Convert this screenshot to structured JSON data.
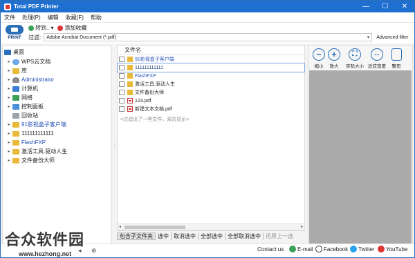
{
  "window": {
    "title": "Total PDF Printer",
    "controls": [
      "—",
      "☐",
      "✕"
    ]
  },
  "menu": [
    "文件",
    "处理(P)",
    "编辑",
    "收藏(F)",
    "帮助"
  ],
  "toolbar": {
    "print_label": "PRINT",
    "goto_label": "转到..",
    "fav_label": "添加收藏",
    "filter_label": "过滤:",
    "filter_value": "Adobe Acrobat Document (*.pdf)",
    "advanced_filter": "Advanced filter"
  },
  "tree": [
    {
      "label": "桌面",
      "icon": "desktop-icon",
      "expand": "",
      "indent": 0,
      "blue": false
    },
    {
      "label": "WPS云文档",
      "icon": "cloud-icon",
      "expand": "▸",
      "indent": 1,
      "blue": false
    },
    {
      "label": "库",
      "icon": "folder-icon",
      "expand": "▸",
      "indent": 1,
      "blue": false
    },
    {
      "label": "Administrator",
      "icon": "user-icon",
      "expand": "▸",
      "indent": 1,
      "blue": true
    },
    {
      "label": "计算机",
      "icon": "computer-icon",
      "expand": "▸",
      "indent": 1,
      "blue": false
    },
    {
      "label": "网络",
      "icon": "network-icon",
      "expand": "▸",
      "indent": 1,
      "blue": false
    },
    {
      "label": "控制面板",
      "icon": "control-panel-icon",
      "expand": "▸",
      "indent": 1,
      "blue": false
    },
    {
      "label": "回收站",
      "icon": "recycle-bin-icon",
      "expand": "",
      "indent": 1,
      "blue": false
    },
    {
      "label": "91影视盒子客户端",
      "icon": "folder-icon",
      "expand": "▸",
      "indent": 1,
      "blue": true
    },
    {
      "label": "111111111111",
      "icon": "folder-icon",
      "expand": "▸",
      "indent": 1,
      "blue": false
    },
    {
      "label": "FlashFXP",
      "icon": "folder-icon",
      "expand": "▸",
      "indent": 1,
      "blue": true
    },
    {
      "label": "激活工具.驱动人生",
      "icon": "folder-icon",
      "expand": "▸",
      "indent": 1,
      "blue": false
    },
    {
      "label": "文件备份大师",
      "icon": "folder-icon",
      "expand": "▸",
      "indent": 1,
      "blue": false
    }
  ],
  "files": {
    "column_header": "文件名",
    "rows": [
      {
        "name": "91影视盒子客户端",
        "type": "folder",
        "selected": false,
        "blue": true
      },
      {
        "name": "111111111111",
        "type": "folder",
        "selected": true,
        "blue": false
      },
      {
        "name": "FlashFXP",
        "type": "folder",
        "selected": false,
        "blue": true
      },
      {
        "name": "激活工具.驱动人生",
        "type": "folder",
        "selected": false,
        "blue": false
      },
      {
        "name": "文件备份大师",
        "type": "folder",
        "selected": false,
        "blue": false
      },
      {
        "name": "123.pdf",
        "type": "pdf",
        "selected": false,
        "blue": false
      },
      {
        "name": "新建文本文档.pdf",
        "type": "pdf",
        "selected": false,
        "blue": false
      }
    ],
    "hint": "<过滤出了一些文件，双击显示>"
  },
  "selection_bar": [
    "包含子文件夹",
    "选中",
    "取消选中",
    "全部选中",
    "全部取消选中",
    "还原上一选"
  ],
  "preview_toolbar": [
    {
      "label": "缩小",
      "icon": "zoom-out-icon",
      "glyph": "−"
    },
    {
      "label": "放大",
      "icon": "zoom-in-icon",
      "glyph": "+"
    },
    {
      "label": "实际大小",
      "icon": "actual-size-icon",
      "glyph": "⛶"
    },
    {
      "label": "适应宽度",
      "icon": "fit-width-icon",
      "glyph": "↔"
    },
    {
      "label": "整页",
      "icon": "whole-page-icon",
      "glyph": ""
    }
  ],
  "footer": {
    "contact_us": "Contact us",
    "email": "E-mail",
    "facebook": "Facebook",
    "twitter": "Twitter",
    "youtube": "YouTube"
  },
  "watermark": {
    "text": "合众软件园",
    "url": "www.hezhong.net"
  },
  "colors": {
    "title_bar": "#1f6fd1",
    "accent": "#2a6fb8",
    "folder": "#e9b93a",
    "preview_bg": "#ababab"
  }
}
